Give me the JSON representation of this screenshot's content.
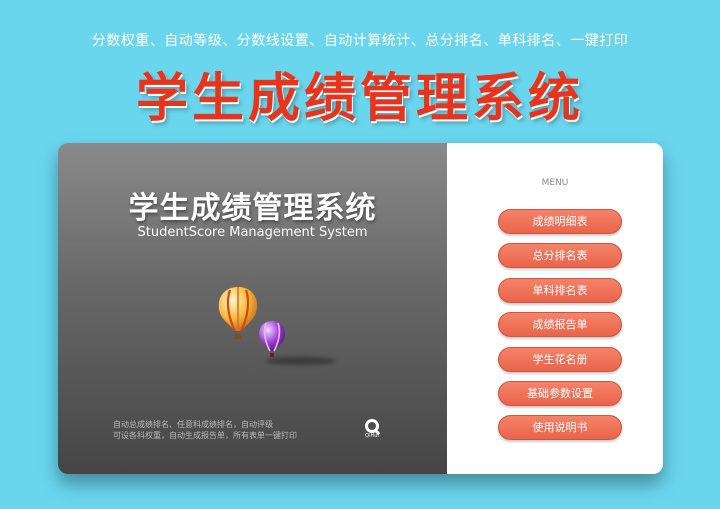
{
  "banner": {
    "tagline": "分数权重、自动等级、分数线设置、自动计算统计、总分排名、单科排名、一键打印",
    "title": "学生成绩管理系统"
  },
  "card": {
    "title": "学生成绩管理系统",
    "subtitle": "StudentScore Management System",
    "description_line1": "自动总成绩排名、任意科成绩排名，自动评级",
    "description_line2": "可设各科权重，自动生成报告单，所有表单一键打印",
    "logo_text": "QiHui"
  },
  "menu": {
    "label": "MENU",
    "items": [
      {
        "label": "成绩明细表"
      },
      {
        "label": "总分排名表"
      },
      {
        "label": "单科排名表"
      },
      {
        "label": "成绩报告单"
      },
      {
        "label": "学生花名册"
      },
      {
        "label": "基础参数设置"
      },
      {
        "label": "使用说明书"
      }
    ]
  },
  "colors": {
    "background": "#6ad6ee",
    "banner_title": "#e8341c",
    "menu_button": "#ee6b50",
    "left_panel": "#6a6a6a"
  },
  "icons": [
    "hot-air-balloon-icon",
    "hot-air-balloon-icon",
    "logo-icon"
  ]
}
